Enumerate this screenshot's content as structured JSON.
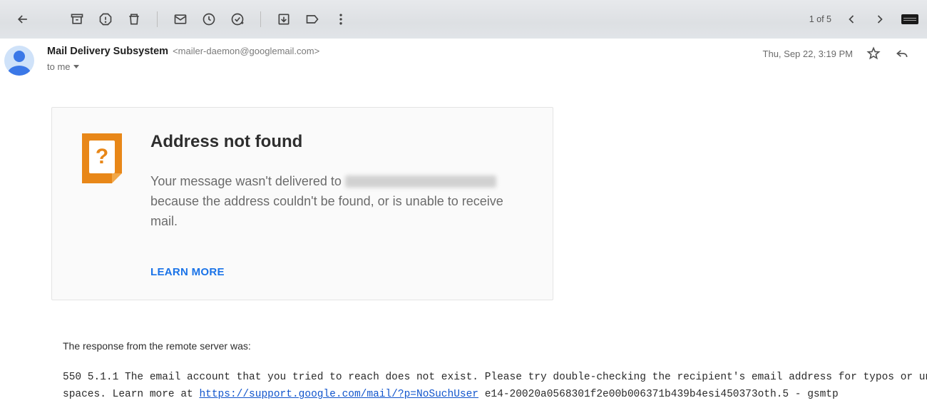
{
  "toolbar": {
    "counter": "1 of 5"
  },
  "header": {
    "sender_name": "Mail Delivery Subsystem",
    "sender_address": "<mailer-daemon@googlemail.com>",
    "to_line": "to me",
    "timestamp": "Thu, Sep 22, 3:19 PM"
  },
  "notice": {
    "icon_glyph": "?",
    "title": "Address not found",
    "text_pre": "Your message wasn't delivered to ",
    "text_post": " because the address couldn't be found, or is unable to receive mail.",
    "learn_more": "LEARN MORE"
  },
  "response": {
    "intro": "The response from the remote server was:",
    "line1_pre": "550 5.1.1 The email account that you tried to reach does not exist. Please try double-checking the recipient's email address for typos or unnecessary",
    "line2_pre": "spaces. Learn more at ",
    "link_text": "https://support.google.com/mail/?p=NoSuchUser",
    "line2_post": " e14-20020a0568301f2e00b006371b439b4esi450373oth.5 - gsmtp"
  }
}
